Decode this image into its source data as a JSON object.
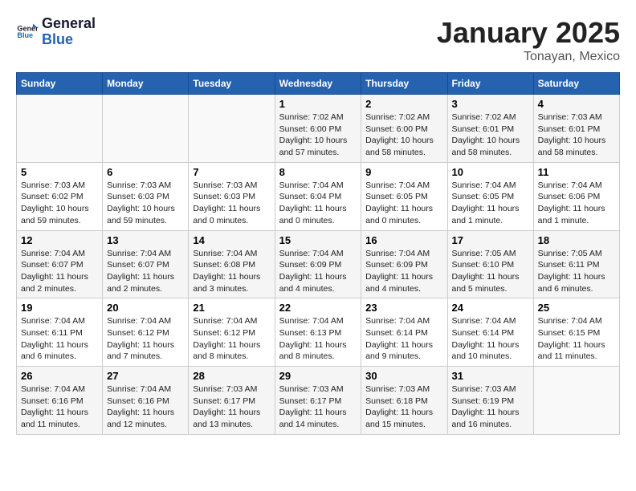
{
  "logo": {
    "text1": "General",
    "text2": "Blue"
  },
  "title": "January 2025",
  "location": "Tonayan, Mexico",
  "weekdays": [
    "Sunday",
    "Monday",
    "Tuesday",
    "Wednesday",
    "Thursday",
    "Friday",
    "Saturday"
  ],
  "weeks": [
    [
      {
        "day": "",
        "info": ""
      },
      {
        "day": "",
        "info": ""
      },
      {
        "day": "",
        "info": ""
      },
      {
        "day": "1",
        "info": "Sunrise: 7:02 AM\nSunset: 6:00 PM\nDaylight: 10 hours\nand 57 minutes."
      },
      {
        "day": "2",
        "info": "Sunrise: 7:02 AM\nSunset: 6:00 PM\nDaylight: 10 hours\nand 58 minutes."
      },
      {
        "day": "3",
        "info": "Sunrise: 7:02 AM\nSunset: 6:01 PM\nDaylight: 10 hours\nand 58 minutes."
      },
      {
        "day": "4",
        "info": "Sunrise: 7:03 AM\nSunset: 6:01 PM\nDaylight: 10 hours\nand 58 minutes."
      }
    ],
    [
      {
        "day": "5",
        "info": "Sunrise: 7:03 AM\nSunset: 6:02 PM\nDaylight: 10 hours\nand 59 minutes."
      },
      {
        "day": "6",
        "info": "Sunrise: 7:03 AM\nSunset: 6:03 PM\nDaylight: 10 hours\nand 59 minutes."
      },
      {
        "day": "7",
        "info": "Sunrise: 7:03 AM\nSunset: 6:03 PM\nDaylight: 11 hours\nand 0 minutes."
      },
      {
        "day": "8",
        "info": "Sunrise: 7:04 AM\nSunset: 6:04 PM\nDaylight: 11 hours\nand 0 minutes."
      },
      {
        "day": "9",
        "info": "Sunrise: 7:04 AM\nSunset: 6:05 PM\nDaylight: 11 hours\nand 0 minutes."
      },
      {
        "day": "10",
        "info": "Sunrise: 7:04 AM\nSunset: 6:05 PM\nDaylight: 11 hours\nand 1 minute."
      },
      {
        "day": "11",
        "info": "Sunrise: 7:04 AM\nSunset: 6:06 PM\nDaylight: 11 hours\nand 1 minute."
      }
    ],
    [
      {
        "day": "12",
        "info": "Sunrise: 7:04 AM\nSunset: 6:07 PM\nDaylight: 11 hours\nand 2 minutes."
      },
      {
        "day": "13",
        "info": "Sunrise: 7:04 AM\nSunset: 6:07 PM\nDaylight: 11 hours\nand 2 minutes."
      },
      {
        "day": "14",
        "info": "Sunrise: 7:04 AM\nSunset: 6:08 PM\nDaylight: 11 hours\nand 3 minutes."
      },
      {
        "day": "15",
        "info": "Sunrise: 7:04 AM\nSunset: 6:09 PM\nDaylight: 11 hours\nand 4 minutes."
      },
      {
        "day": "16",
        "info": "Sunrise: 7:04 AM\nSunset: 6:09 PM\nDaylight: 11 hours\nand 4 minutes."
      },
      {
        "day": "17",
        "info": "Sunrise: 7:05 AM\nSunset: 6:10 PM\nDaylight: 11 hours\nand 5 minutes."
      },
      {
        "day": "18",
        "info": "Sunrise: 7:05 AM\nSunset: 6:11 PM\nDaylight: 11 hours\nand 6 minutes."
      }
    ],
    [
      {
        "day": "19",
        "info": "Sunrise: 7:04 AM\nSunset: 6:11 PM\nDaylight: 11 hours\nand 6 minutes."
      },
      {
        "day": "20",
        "info": "Sunrise: 7:04 AM\nSunset: 6:12 PM\nDaylight: 11 hours\nand 7 minutes."
      },
      {
        "day": "21",
        "info": "Sunrise: 7:04 AM\nSunset: 6:12 PM\nDaylight: 11 hours\nand 8 minutes."
      },
      {
        "day": "22",
        "info": "Sunrise: 7:04 AM\nSunset: 6:13 PM\nDaylight: 11 hours\nand 8 minutes."
      },
      {
        "day": "23",
        "info": "Sunrise: 7:04 AM\nSunset: 6:14 PM\nDaylight: 11 hours\nand 9 minutes."
      },
      {
        "day": "24",
        "info": "Sunrise: 7:04 AM\nSunset: 6:14 PM\nDaylight: 11 hours\nand 10 minutes."
      },
      {
        "day": "25",
        "info": "Sunrise: 7:04 AM\nSunset: 6:15 PM\nDaylight: 11 hours\nand 11 minutes."
      }
    ],
    [
      {
        "day": "26",
        "info": "Sunrise: 7:04 AM\nSunset: 6:16 PM\nDaylight: 11 hours\nand 11 minutes."
      },
      {
        "day": "27",
        "info": "Sunrise: 7:04 AM\nSunset: 6:16 PM\nDaylight: 11 hours\nand 12 minutes."
      },
      {
        "day": "28",
        "info": "Sunrise: 7:03 AM\nSunset: 6:17 PM\nDaylight: 11 hours\nand 13 minutes."
      },
      {
        "day": "29",
        "info": "Sunrise: 7:03 AM\nSunset: 6:17 PM\nDaylight: 11 hours\nand 14 minutes."
      },
      {
        "day": "30",
        "info": "Sunrise: 7:03 AM\nSunset: 6:18 PM\nDaylight: 11 hours\nand 15 minutes."
      },
      {
        "day": "31",
        "info": "Sunrise: 7:03 AM\nSunset: 6:19 PM\nDaylight: 11 hours\nand 16 minutes."
      },
      {
        "day": "",
        "info": ""
      }
    ]
  ]
}
